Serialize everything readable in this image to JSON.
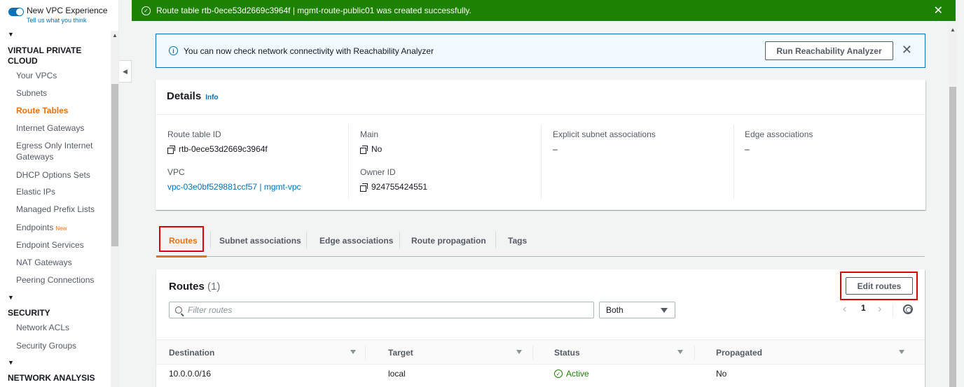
{
  "sidebar": {
    "toggle_title": "New VPC Experience",
    "toggle_sub": "Tell us what you think",
    "sections": [
      {
        "title": "VIRTUAL PRIVATE CLOUD"
      },
      {
        "title": "SECURITY"
      },
      {
        "title": "NETWORK ANALYSIS"
      }
    ],
    "vpc_items": [
      "Your VPCs",
      "Subnets",
      "Route Tables",
      "Internet Gateways",
      "Egress Only Internet Gateways",
      "DHCP Options Sets",
      "Elastic IPs",
      "Managed Prefix Lists",
      "Endpoints",
      "Endpoint Services",
      "NAT Gateways",
      "Peering Connections"
    ],
    "new_badge": "New",
    "security_items": [
      "Network ACLs",
      "Security Groups"
    ],
    "active_item": "Route Tables"
  },
  "flash": {
    "message": "Route table rtb-0ece53d2669c3964f | mgmt-route-public01 was created successfully.",
    "color": "#1d8102"
  },
  "banner": {
    "message": "You can now check network connectivity with Reachability Analyzer",
    "button": "Run Reachability Analyzer"
  },
  "details": {
    "title": "Details",
    "info": "Info",
    "route_table_id_label": "Route table ID",
    "route_table_id": "rtb-0ece53d2669c3964f",
    "vpc_label": "VPC",
    "vpc_value": "vpc-03e0bf529881ccf57 | mgmt-vpc",
    "main_label": "Main",
    "main_value": "No",
    "owner_label": "Owner ID",
    "owner_value": "924755424551",
    "explicit_label": "Explicit subnet associations",
    "explicit_value": "–",
    "edge_label": "Edge associations",
    "edge_value": "–"
  },
  "tabs": [
    "Routes",
    "Subnet associations",
    "Edge associations",
    "Route propagation",
    "Tags"
  ],
  "routes": {
    "title": "Routes",
    "count": "(1)",
    "edit_button": "Edit routes",
    "filter_placeholder": "Filter routes",
    "select_value": "Both",
    "page": "1",
    "columns": [
      "Destination",
      "Target",
      "Status",
      "Propagated"
    ],
    "rows": [
      {
        "destination": "10.0.0.0/16",
        "target": "local",
        "status": "Active",
        "propagated": "No"
      }
    ]
  },
  "colors": {
    "accent": "#ec7211",
    "link": "#0073bb",
    "highlight": "#df0000"
  }
}
